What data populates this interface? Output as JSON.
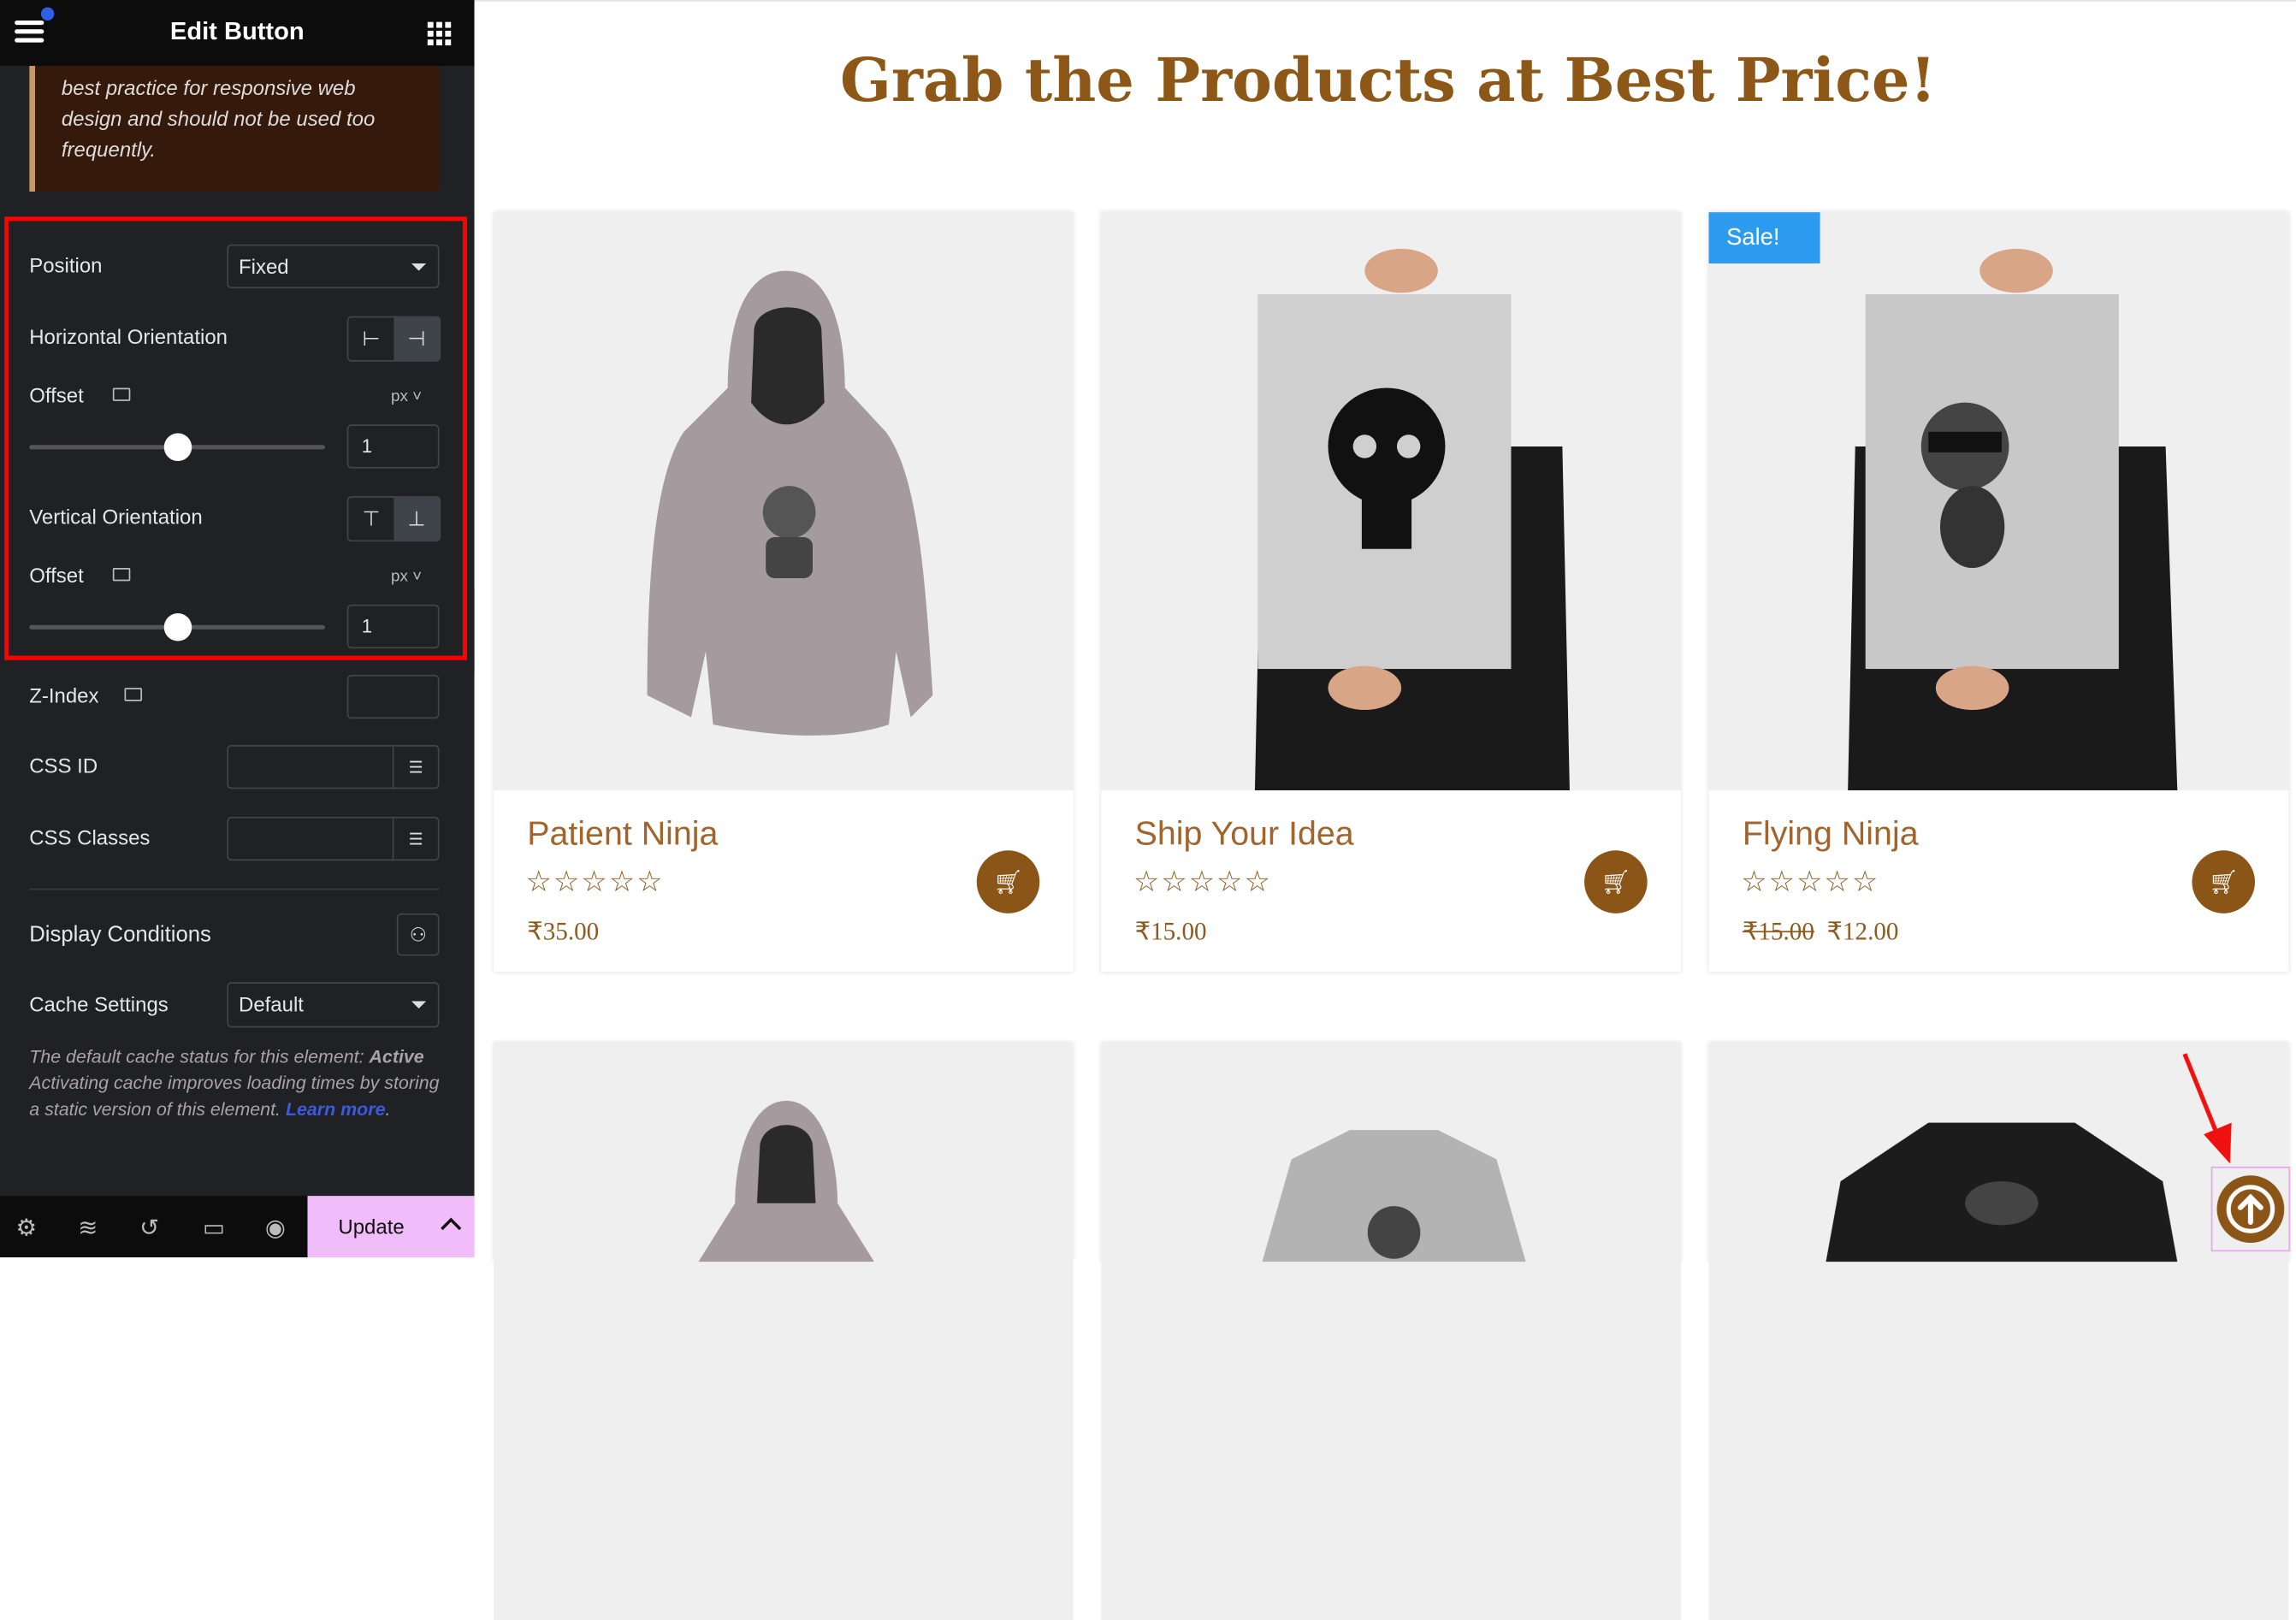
{
  "panel": {
    "title": "Edit Button",
    "note": [
      "best practice for responsive web",
      "design and should not be used too",
      "frequently."
    ],
    "position": {
      "label": "Position",
      "value": "Fixed"
    },
    "horizontal": {
      "label": "Horizontal Orientation",
      "options": [
        "left",
        "right"
      ],
      "selected": "right"
    },
    "h_offset": {
      "label": "Offset",
      "unit": "px",
      "value": "1"
    },
    "vertical": {
      "label": "Vertical Orientation",
      "options": [
        "top",
        "bottom"
      ],
      "selected": "bottom"
    },
    "v_offset": {
      "label": "Offset",
      "unit": "px",
      "value": "1"
    },
    "zindex": {
      "label": "Z-Index",
      "value": ""
    },
    "css_id": {
      "label": "CSS ID",
      "value": ""
    },
    "css_classes": {
      "label": "CSS Classes",
      "value": ""
    },
    "display_conditions": {
      "label": "Display Conditions"
    },
    "cache": {
      "label": "Cache Settings",
      "value": "Default"
    },
    "cache_note": {
      "text": "The default cache status for this element: ",
      "bold": "Active",
      "text2": " Activating cache improves loading times by storing a static version of this element. ",
      "link": "Learn more",
      "end": "."
    },
    "footer": {
      "update": "Update"
    }
  },
  "page": {
    "title": "Grab the Products at Best Price!",
    "products": [
      {
        "name": "Patient Ninja",
        "stars": "☆☆☆☆☆",
        "price": "₹35.00",
        "old_price": "",
        "sale": ""
      },
      {
        "name": "Ship Your Idea",
        "stars": "☆☆☆☆☆",
        "price": "₹15.00",
        "old_price": "",
        "sale": ""
      },
      {
        "name": "Flying Ninja",
        "stars": "☆☆☆☆☆",
        "price": "₹12.00",
        "old_price": "₹15.00",
        "sale": "Sale!"
      }
    ]
  },
  "colors": {
    "accent": "#8a5516",
    "update_bg": "#f0bdfa",
    "highlight": "#ff0000",
    "link": "#3b5bdb"
  }
}
